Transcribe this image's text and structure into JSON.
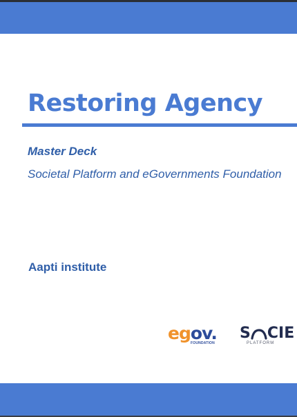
{
  "slide": {
    "title": "Restoring Agency",
    "subtitle": "Master Deck",
    "organizations_line": "Societal Platform and eGovernments Foundation",
    "author": "Aapti institute"
  },
  "logos": {
    "egov": {
      "mark_e": "e",
      "mark_g": "g",
      "mark_ov": "ov",
      "dot": ".",
      "subtext": "FOUNDATION"
    },
    "societal": {
      "mark_s": "S",
      "mark_rest": "CIE",
      "subtext": "PLATFORM"
    }
  },
  "colors": {
    "band": "#4a7bd2",
    "text_blue": "#2f5ea8",
    "egov_orange": "#f0922b",
    "egov_navy": "#2d4c9b",
    "societal_navy": "#222c4f"
  }
}
